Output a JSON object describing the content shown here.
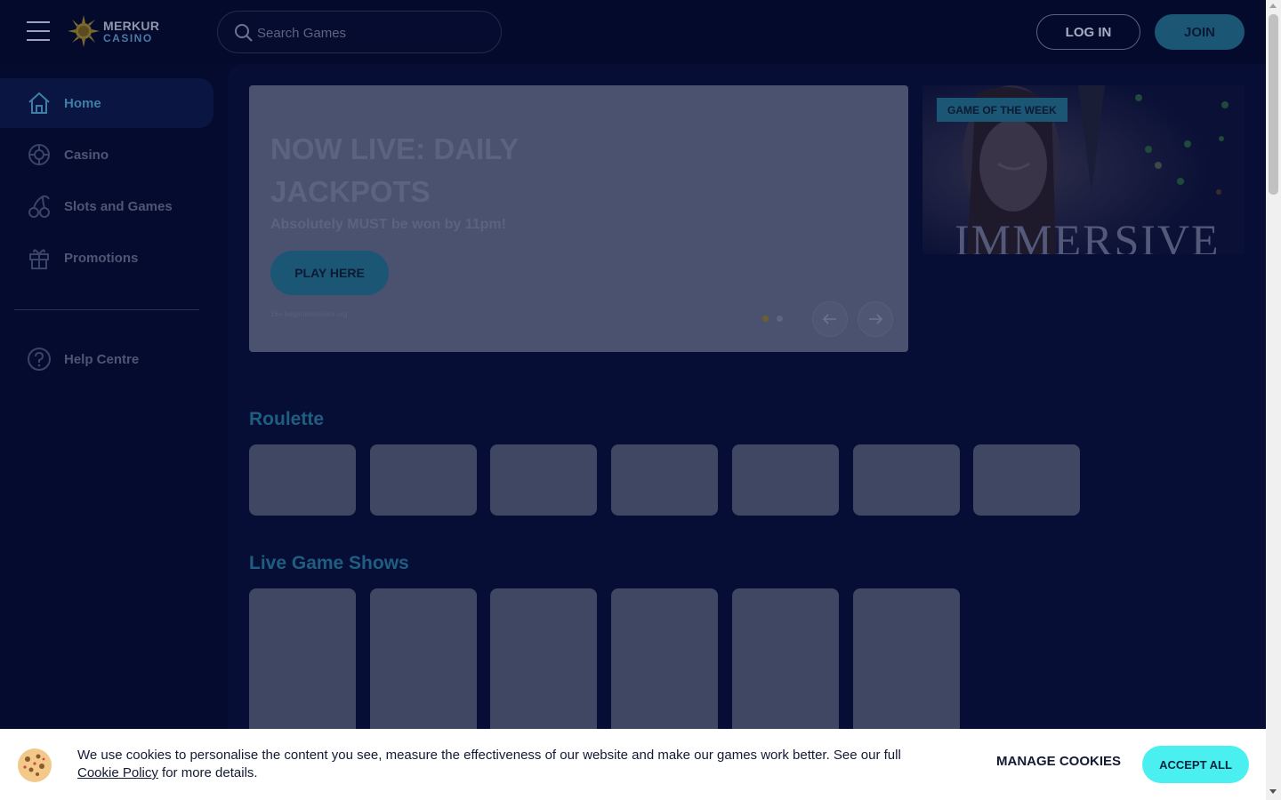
{
  "header": {
    "logo_line1": "MERKUR",
    "logo_line2": "CASINO",
    "search_placeholder": "Search Games",
    "login_label": "LOG IN",
    "join_label": "JOIN"
  },
  "sidebar": {
    "items": [
      {
        "label": "Home",
        "icon": "home-icon",
        "active": true
      },
      {
        "label": "Casino",
        "icon": "roulette-icon",
        "active": false
      },
      {
        "label": "Slots and Games",
        "icon": "cherries-icon",
        "active": false
      },
      {
        "label": "Promotions",
        "icon": "gift-icon",
        "active": false
      }
    ],
    "help_label": "Help Centre"
  },
  "hero": {
    "title": "NOW LIVE: DAILY JACKPOTS",
    "subtitle": "Absolutely MUST be won by 11pm!",
    "button_label": "PLAY HERE",
    "legal": "18+ begambleaware.org"
  },
  "game_of_week": {
    "badge": "GAME OF THE WEEK",
    "image_text": "IMMERSIVE"
  },
  "sections": [
    {
      "title": "Roulette",
      "tile_count": 7
    },
    {
      "title": "Live Game Shows",
      "tile_count": 6
    }
  ],
  "cookie_banner": {
    "text": "We use cookies to personalise the content you see, measure the effectiveness of our website and make our games work better. See our full",
    "link": "Cookie Policy",
    "text_after": "for more details.",
    "manage_label": "MANAGE COOKIES",
    "accept_label": "ACCEPT ALL"
  },
  "colors": {
    "background": "#050b2e",
    "accent": "#1b5675",
    "accept": "#4af0f0"
  }
}
